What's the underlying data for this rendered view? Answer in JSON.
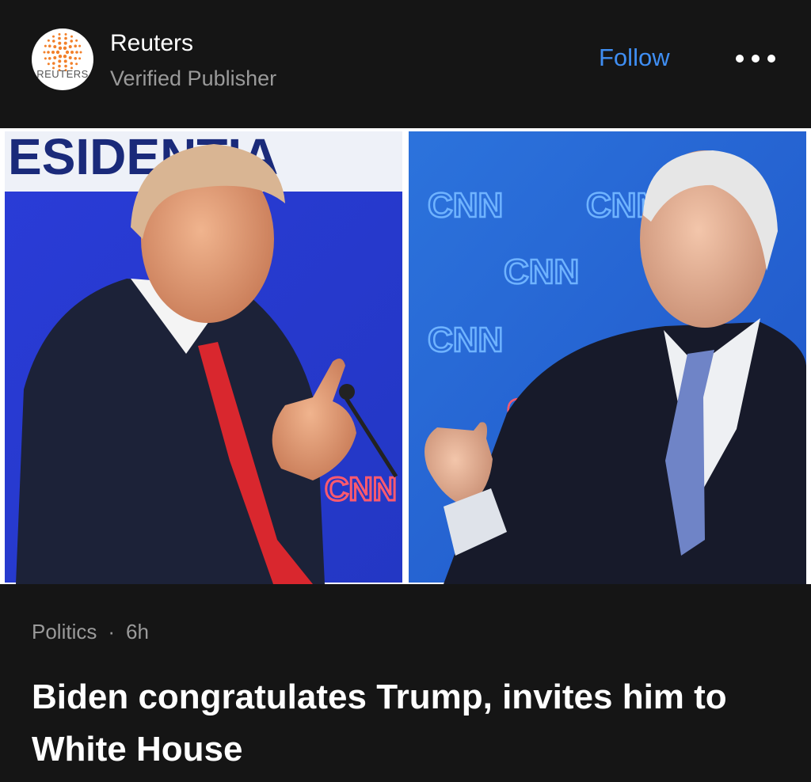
{
  "publisher": {
    "name": "Reuters",
    "subtitle": "Verified Publisher",
    "logo_text": "REUTERS",
    "avatar_icon": "reuters-logo-icon"
  },
  "actions": {
    "follow_label": "Follow",
    "more_icon": "more-horizontal-icon"
  },
  "photo": {
    "banner_text": "ESIDENTIA",
    "left_watermark": "CNN",
    "right_watermarks": [
      "CNN",
      "CNN",
      "CNN",
      "CNN",
      "CN"
    ]
  },
  "article": {
    "category": "Politics",
    "separator": "·",
    "time": "6h",
    "headline": "Biden congratulates Trump, invites him to White House"
  },
  "colors": {
    "background": "#151515",
    "accent": "#3f8ef2",
    "muted_text": "#9a9a9a",
    "logo_orange": "#f2802a"
  }
}
